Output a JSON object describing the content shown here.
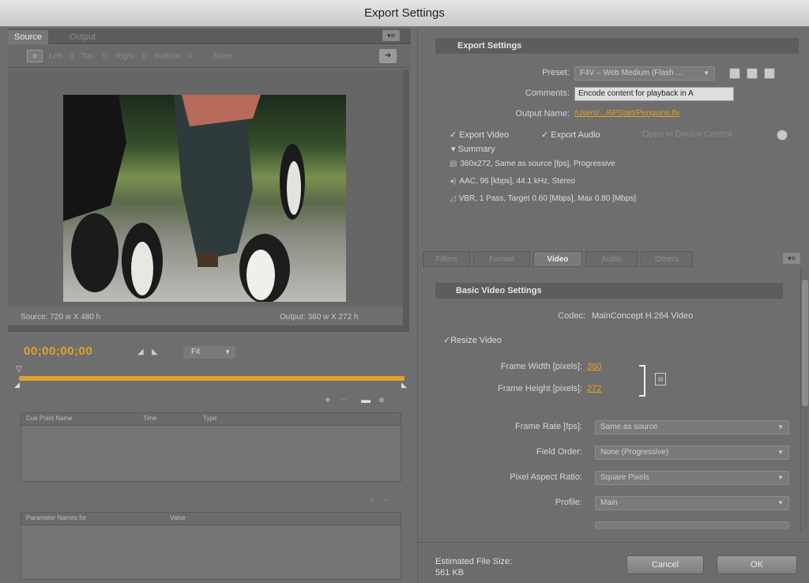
{
  "window": {
    "title": "Export Settings"
  },
  "source_panel": {
    "tabs": [
      {
        "label": "Source"
      },
      {
        "label": "Output"
      }
    ],
    "crop": {
      "left_label": "Left:",
      "left_value": "0",
      "top_label": "Top:",
      "top_value": "0",
      "right_label": "Right:",
      "right_value": "0",
      "bottom_label": "Bottom:",
      "bottom_value": "0",
      "ratio_value": "None"
    },
    "source_info": "Source: 720 w X 480 h",
    "output_info": "Output: 360 w X 272 h",
    "timecode": "00;00;00;00",
    "zoom_value": "Fit",
    "cue_table": {
      "columns": [
        "Cue Point Name",
        "Time",
        "Type"
      ]
    },
    "param_table": {
      "columns": [
        "Parameter Names for",
        "Value"
      ]
    }
  },
  "export_settings": {
    "header": "Export Settings",
    "preset_label": "Preset:",
    "preset_value": "F4V – Web Medium (Flash ...",
    "comments_label": "Comments:",
    "comments_value": "Encode content for playback in A",
    "output_name_label": "Output Name:",
    "output_name_value": "/Users/.../6PStart/Penguins.flv",
    "export_video_label": "Export Video",
    "export_audio_label": "Export Audio",
    "device_central_label": "Open in Device Central",
    "summary_label": "Summary",
    "summary_lines": [
      "360x272, Same as source [fps], Progressive",
      "AAC, 96 [kbps], 44.1 kHz, Stereo",
      "VBR, 1 Pass, Target 0.60 [Mbps], Max 0.80 [Mbps]"
    ]
  },
  "settings_tabs": [
    {
      "label": "Filters"
    },
    {
      "label": "Format"
    },
    {
      "label": "Video"
    },
    {
      "label": "Audio"
    },
    {
      "label": "Others"
    }
  ],
  "video_settings": {
    "header": "Basic Video Settings",
    "codec_label": "Codec:",
    "codec_value": "MainConcept H.264 Video",
    "resize_label": "Resize Video",
    "frame_width_label": "Frame Width [pixels]:",
    "frame_width_value": "360",
    "frame_height_label": "Frame Height [pixels]:",
    "frame_height_value": "272",
    "frame_rate_label": "Frame Rate [fps]:",
    "frame_rate_value": "Same as source",
    "field_order_label": "Field Order:",
    "field_order_value": "None (Progressive)",
    "pixel_aspect_label": "Pixel Aspect Ratio:",
    "pixel_aspect_value": "Square Pixels",
    "profile_label": "Profile:",
    "profile_value": "Main"
  },
  "footer": {
    "estimated_label": "Estimated File Size:",
    "estimated_value": "561 KB",
    "cancel_label": "Cancel",
    "ok_label": "OK"
  },
  "colors": {
    "accent": "#e0a12a",
    "panel": "#6e6e6e",
    "header": "#5d5d5d"
  }
}
